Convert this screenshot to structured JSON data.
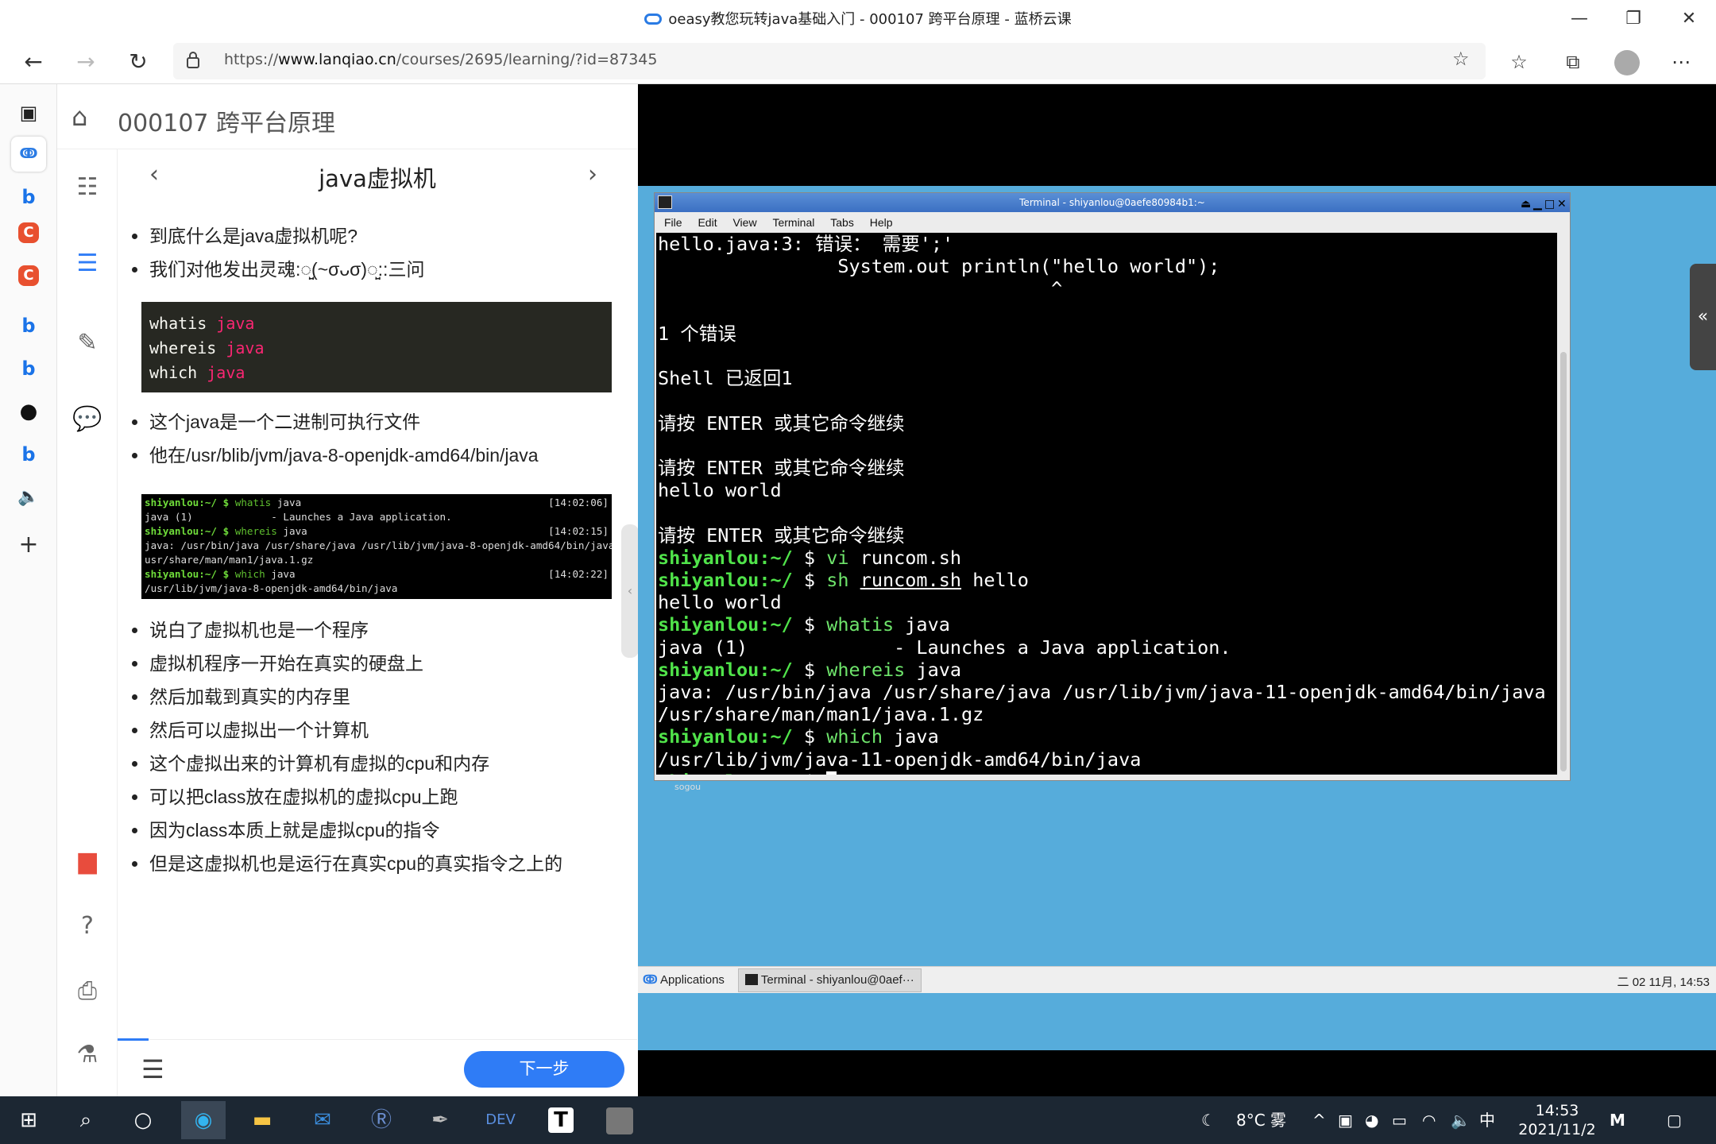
{
  "window": {
    "title": "oeasy教您玩转java基础入门 - 000107 跨平台原理 - 蓝桥云课",
    "minimize": "—",
    "restore": "❐",
    "close": "✕"
  },
  "browser": {
    "url_prefix": "https://",
    "url_host": "www.lanqiao.cn",
    "url_path": "/courses/2695/learning/?id=87345"
  },
  "course": {
    "title": "000107 跨平台原理",
    "section_title": "java虚拟机",
    "bullets1": [
      "到底什么是java虚拟机呢?",
      "我们对他发出灵魂:◌̤̮(~σᴗσ)◌̤̮::三问"
    ],
    "code": [
      {
        "cmd": "whatis",
        "arg": "java"
      },
      {
        "cmd": "whereis",
        "arg": "java"
      },
      {
        "cmd": "which",
        "arg": "java"
      }
    ],
    "bullets2": [
      "这个java是一个二进制可执行文件",
      "他在/usr/blib/jvm/java-8-openjdk-amd64/bin/java"
    ],
    "shot": {
      "prompt": "shiyanlou:~/ $",
      "l1_cmd": "whatis",
      "l1_arg": "java",
      "l1_time": "[14:02:06]",
      "l2": "java (1)             - Launches a Java application.",
      "l3_cmd": "whereis",
      "l3_arg": "java",
      "l3_time": "[14:02:15]",
      "l4": "java: /usr/bin/java /usr/share/java /usr/lib/jvm/java-8-openjdk-amd64/bin/java /",
      "l5": "usr/share/man/man1/java.1.gz",
      "l6_cmd": "which",
      "l6_arg": "java",
      "l6_time": "[14:02:22]",
      "l7": "/usr/lib/jvm/java-8-openjdk-amd64/bin/java"
    },
    "bullets3": [
      "说白了虚拟机也是一个程序",
      "虚拟机程序一开始在真实的硬盘上",
      "然后加载到真实的内存里",
      "然后可以虚拟出一个计算机",
      "这个虚拟出来的计算机有虚拟的cpu和内存",
      "可以把class放在虚拟机的虚拟cpu上跑",
      "因为class本质上就是虚拟cpu的指令",
      "但是这虚拟机也是运行在真实cpu的真实指令之上的"
    ],
    "next_button": "下一步",
    "progress_fraction": 0.06
  },
  "terminal": {
    "window_title": "Terminal - shiyanlou@0aefe80984b1:~",
    "menu": [
      "File",
      "Edit",
      "View",
      "Terminal",
      "Tabs",
      "Help"
    ],
    "prompt_user": "shiyanlou:~/",
    "lines": {
      "l1": "hello.java:3: 错误： 需要';'",
      "l2": "                System.out println(\"hello world\");",
      "l3": "                                   ^",
      "l5": "1 个错误",
      "l7": "Shell 已返回1",
      "l9": "请按 ENTER 或其它命令继续",
      "l11": "请按 ENTER 或其它命令继续",
      "l12": "hello world",
      "l14": "请按 ENTER 或其它命令继续",
      "c1_cmd": "vi",
      "c1_arg": "runcom.sh",
      "c2_cmd": "sh",
      "c2_arg": "runcom.sh",
      "c2_arg2": "hello",
      "o2": "hello world",
      "c3_cmd": "whatis",
      "c3_arg": "java",
      "o3": "java (1)             - Launches a Java application.",
      "c4_cmd": "whereis",
      "c4_arg": "java",
      "o4a": "java: /usr/bin/java /usr/share/java /usr/lib/jvm/java-11-openjdk-amd64/bin/java",
      "o4b": "/usr/share/man/man1/java.1.gz",
      "c5_cmd": "which",
      "c5_arg": "java",
      "o5": "/usr/lib/jvm/java-11-openjdk-amd64/bin/java"
    }
  },
  "desktop": {
    "sogou_label": "sogou",
    "panel_apps": "Applications",
    "panel_task": "Terminal - shiyanlou@0aef···",
    "panel_clock": "二 02 11月, 14:53"
  },
  "taskbar": {
    "weather": "8°C 雾",
    "ime": "中",
    "time": "14:53",
    "date": "2021/11/2"
  }
}
